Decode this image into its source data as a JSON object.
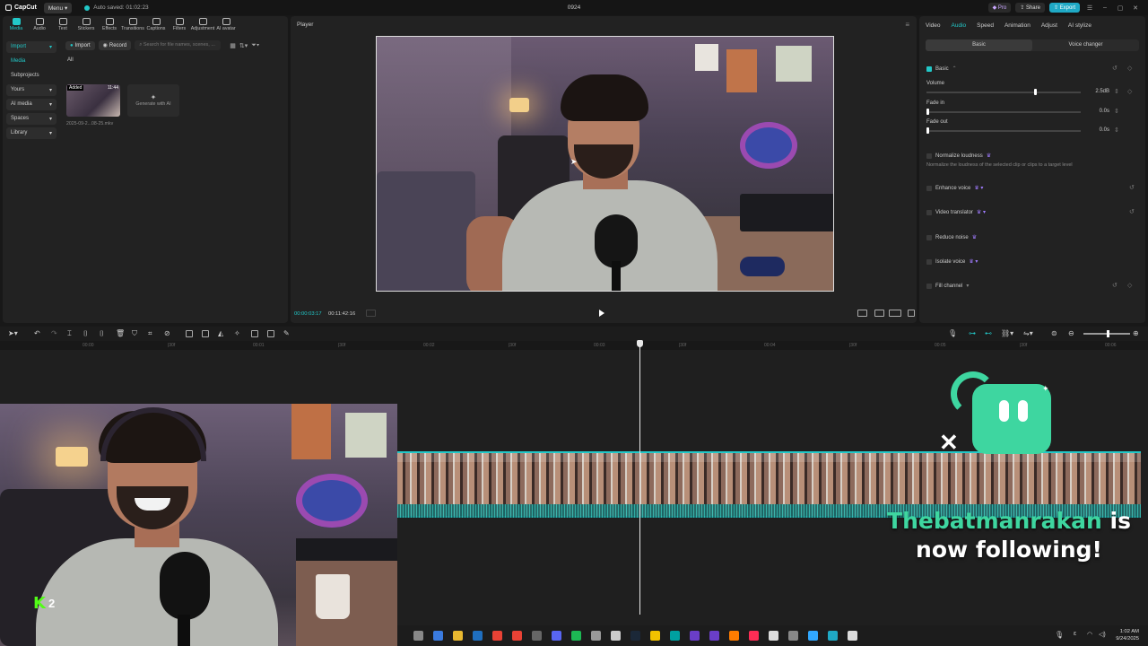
{
  "app": {
    "name": "CapCut",
    "menu_label": "Menu",
    "autosave": "Auto saved: 01:02:23",
    "project_title": "0924",
    "pro_label": "Pro",
    "share_label": "Share",
    "export_label": "Export",
    "accent_color": "#22c8c8"
  },
  "toolbar_tabs": [
    "Media",
    "Audio",
    "Text",
    "Stickers",
    "Effects",
    "Transitions",
    "Captions",
    "Filters",
    "Adjustment",
    "AI avatar"
  ],
  "media": {
    "side_nav": [
      {
        "label": "Import",
        "arrow": "▾"
      },
      {
        "label": "Media",
        "arrow": ""
      },
      {
        "label": "Subprojects",
        "arrow": ""
      },
      {
        "label": "Yours",
        "arrow": "▾"
      },
      {
        "label": "AI media",
        "arrow": "▾"
      },
      {
        "label": "Spaces",
        "arrow": "▾"
      },
      {
        "label": "Library",
        "arrow": "▾"
      }
    ],
    "import_button": "Import",
    "record_button": "Record",
    "search_placeholder": "Search for file names, scenes, ...",
    "filter_all": "All",
    "clip": {
      "added_badge": "Added",
      "duration": "11:44",
      "filename": "2025-09-2...08-25.mkv"
    },
    "generate_ai": "Generate with AI"
  },
  "player": {
    "title": "Player",
    "current_time": "00:00:03:17",
    "total_time": "00:11:42:16"
  },
  "properties": {
    "tabs": [
      "Video",
      "Audio",
      "Speed",
      "Animation",
      "Adjust",
      "AI stylize"
    ],
    "active_tab": "Audio",
    "segments": [
      "Basic",
      "Voice changer"
    ],
    "section_basic": "Basic",
    "volume_label": "Volume",
    "volume_value": "2.5dB",
    "volume_level": 0.7,
    "fade_in_label": "Fade in",
    "fade_in_value": "0.0s",
    "fade_out_label": "Fade out",
    "fade_out_value": "0.0s",
    "normalize_label": "Normalize loudness",
    "normalize_desc": "Normalize the loudness of the selected clip or clips to a target level",
    "enhance_voice": "Enhance voice",
    "video_translator": "Video translator",
    "reduce_noise": "Reduce noise",
    "isolate_voice": "Isolate voice",
    "fill_channel": "Fill channel"
  },
  "timeline": {
    "ruler_labels": [
      "00:00",
      "|30f",
      "00:01",
      "|30f",
      "00:02",
      "|30f",
      "00:03",
      "|30f",
      "00:04",
      "|30f",
      "00:05",
      "|30f",
      "00:06"
    ]
  },
  "overlay": {
    "kick_count": "2",
    "follower_name": "Thebatmanrakan",
    "follow_suffix": "is",
    "follow_line2": "now following!",
    "alert_color": "#3ed6a0"
  },
  "taskbar": {
    "time": "1:02 AM",
    "date": "9/24/2025",
    "icons": [
      "file-explorer",
      "copilot",
      "folder",
      "outlook",
      "chrome",
      "chrome",
      "unknown",
      "discord",
      "spotify",
      "app",
      "game",
      "steam",
      "notes",
      "audition",
      "premiere",
      "after-effects",
      "illustrator",
      "tiktok",
      "capcut",
      "app",
      "photoshop",
      "app",
      "capcut"
    ]
  }
}
